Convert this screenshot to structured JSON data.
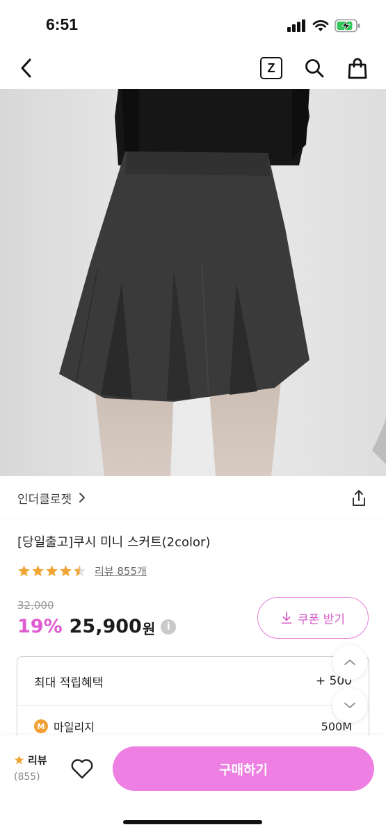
{
  "status_bar": {
    "time": "6:51",
    "icons": [
      "signal-icon",
      "wifi-icon",
      "battery-charging-icon"
    ]
  },
  "nav": {
    "icons": [
      "back-icon",
      "zigzag-z-icon",
      "search-icon",
      "shopping-bag-icon"
    ],
    "z_label": "Z"
  },
  "product": {
    "brand": "인더클로젯",
    "title": "[당일출고]쿠시 미니 스커트(2color)",
    "rating": 4.5,
    "review_link": "리뷰 855개",
    "original_price": "32,000",
    "discount": "19%",
    "price": "25,900",
    "currency": "원",
    "info_glyph": "i"
  },
  "coupon": {
    "label": "쿠폰 받기"
  },
  "benefits": {
    "title": "최대 적립혜택",
    "total": "+ 500",
    "mileage_label": "마일리지",
    "mileage_badge": "M",
    "mileage_value": "500M"
  },
  "bottom_bar": {
    "review_label": "리뷰",
    "review_count": "(855)",
    "buy_label": "구매하기"
  },
  "colors": {
    "accent_pink": "#ee7fe3",
    "discount_pink": "#e05bd1",
    "star_orange": "#f0a535"
  }
}
